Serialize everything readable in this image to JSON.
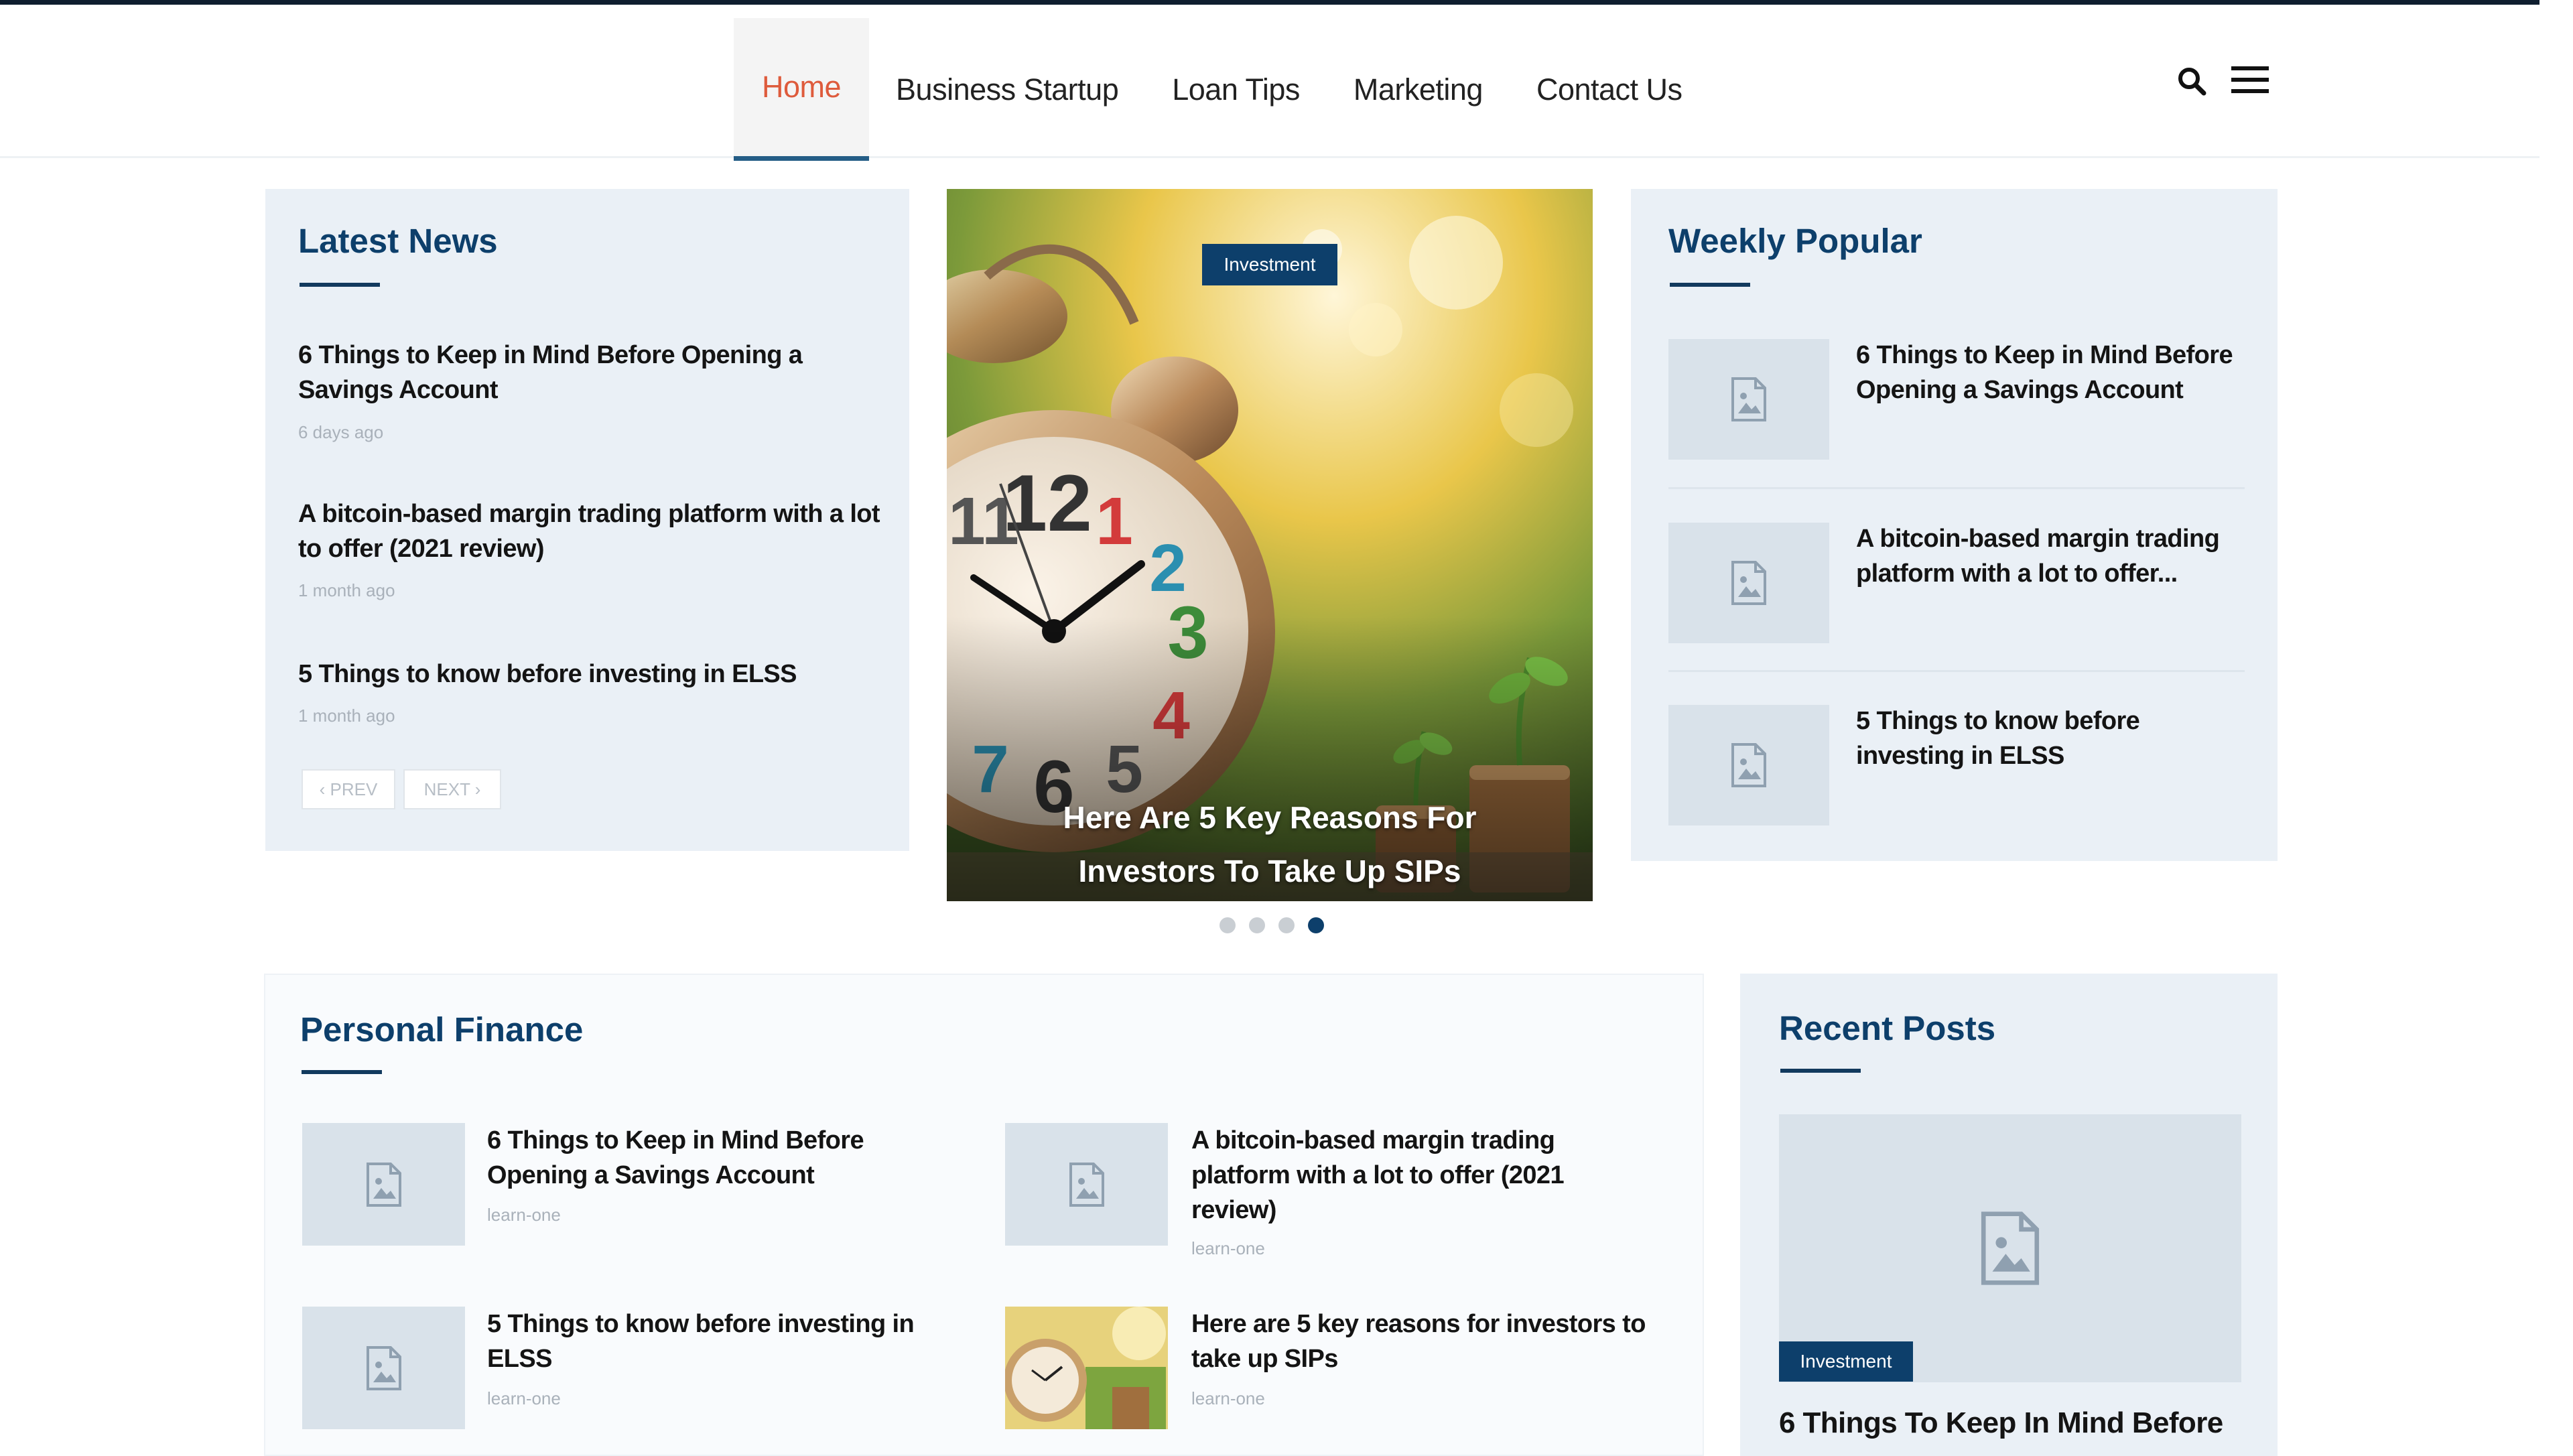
{
  "nav": {
    "items": [
      {
        "label": "Home",
        "active": true
      },
      {
        "label": "Business Startup"
      },
      {
        "label": "Loan Tips"
      },
      {
        "label": "Marketing"
      },
      {
        "label": "Contact Us"
      }
    ],
    "search_icon": "search-icon",
    "menu_icon": "hamburger-menu-icon"
  },
  "latest_news": {
    "title": "Latest News",
    "items": [
      {
        "title": "6 Things to Keep in Mind Before Opening a Savings Account",
        "meta": "6 days ago"
      },
      {
        "title": "A bitcoin-based margin trading platform with a lot to offer (2021 review)",
        "meta": "1 month ago"
      },
      {
        "title": "5 Things to know before investing in ELSS",
        "meta": "1 month ago"
      }
    ],
    "prev_label": "‹ PREV",
    "next_label": "NEXT ›"
  },
  "slider": {
    "badge": "Investment",
    "caption_line1": "Here Are 5 Key Reasons For",
    "caption_line2": "Investors To Take Up SIPs",
    "dots": 4,
    "active_dot": 4
  },
  "weekly_popular": {
    "title": "Weekly Popular",
    "items": [
      {
        "title_line1": "6 Things to Keep in Mind Before",
        "title_line2": "Opening a Savings Account"
      },
      {
        "title_line1": "A bitcoin-based margin trading",
        "title_line2": "platform with a lot to offer..."
      },
      {
        "title_line1": "5 Things to know before",
        "title_line2": "investing in ELSS"
      }
    ]
  },
  "personal_finance": {
    "title": "Personal Finance",
    "items": [
      {
        "title": "6 Things to Keep in Mind Before Opening a Savings Account",
        "meta": "learn-one"
      },
      {
        "title": "A bitcoin-based margin trading platform with a lot to offer (2021 review)",
        "meta": "learn-one"
      },
      {
        "title": "5 Things to know before investing in ELSS",
        "meta": "learn-one"
      },
      {
        "title": "Here are 5 key reasons for investors to take up SIPs",
        "meta": "learn-one"
      }
    ]
  },
  "recent_posts": {
    "title": "Recent Posts",
    "badge": "Investment",
    "post_title": "6 Things To Keep In Mind Before"
  },
  "colors": {
    "accent_active": "#de5b3c",
    "brand_navy": "#0d3f6b",
    "panel_bg": "#eaf0f6"
  }
}
